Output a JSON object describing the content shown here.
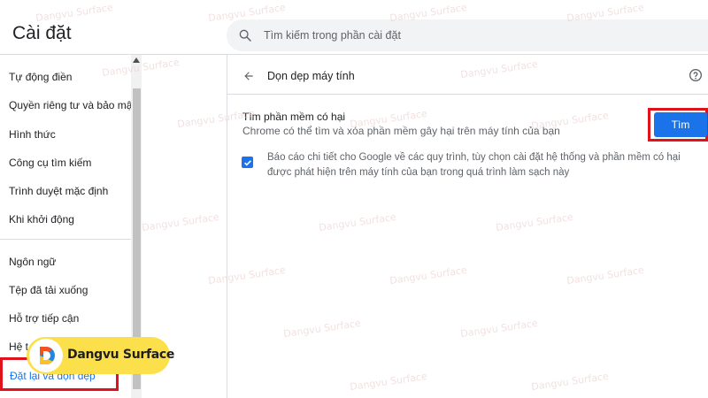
{
  "header": {
    "title": "Cài đặt",
    "search_placeholder": "Tìm kiếm trong phần cài đặt"
  },
  "sidebar": {
    "items": [
      {
        "label": "Tự động điền"
      },
      {
        "label": "Quyền riêng tư và bảo mật"
      },
      {
        "label": "Hình thức"
      },
      {
        "label": "Công cụ tìm kiếm"
      },
      {
        "label": "Trình duyệt mặc định"
      },
      {
        "label": "Khi khởi động"
      },
      {
        "label": "Ngôn ngữ"
      },
      {
        "label": "Tệp đã tải xuống"
      },
      {
        "label": "Hỗ trợ tiếp cận"
      },
      {
        "label": "Hệ t"
      },
      {
        "label": "Đặt lại và dọn dẹp"
      }
    ]
  },
  "content": {
    "page_title": "Dọn dẹp máy tính",
    "section_title": "Tìm phần mềm có hại",
    "section_desc": "Chrome có thể tìm và xóa phần mềm gây hại trên máy tính của bạn",
    "find_label": "Tìm",
    "report_text": "Báo cáo chi tiết cho Google về các quy trình, tùy chọn cài đặt hệ thống và phần mềm có hại được phát hiện trên máy tính của bạn trong quá trình làm sạch này",
    "report_checked": true
  },
  "watermark": {
    "text": "Dangvu Surface",
    "badge_text": "Dangvu Surface"
  },
  "colors": {
    "accent": "#1a73e8",
    "highlight": "#e0131c",
    "badge": "#fce04b"
  },
  "icons": {
    "search": "search-icon",
    "back": "back-arrow-icon",
    "help": "help-icon",
    "check": "check-icon",
    "scroll_up": "scroll-up-arrow-icon"
  }
}
